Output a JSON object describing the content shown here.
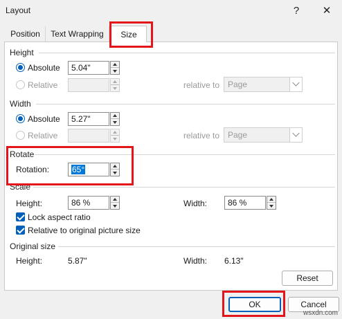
{
  "window": {
    "title": "Layout",
    "help_label": "?",
    "close_label": "✕"
  },
  "tabs": [
    {
      "label": "Position"
    },
    {
      "label": "Text Wrapping"
    },
    {
      "label": "Size"
    }
  ],
  "height": {
    "section": "Height",
    "absolute_label": "Absolute",
    "absolute_value": "5.04\"",
    "relative_label": "Relative",
    "relative_value": "",
    "relative_to_label": "relative to",
    "relative_to_value": "Page"
  },
  "width": {
    "section": "Width",
    "absolute_label": "Absolute",
    "absolute_value": "5.27\"",
    "relative_label": "Relative",
    "relative_value": "",
    "relative_to_label": "relative to",
    "relative_to_value": "Page"
  },
  "rotate": {
    "section": "Rotate",
    "rotation_label": "Rotation:",
    "rotation_value": "65°"
  },
  "scale": {
    "section": "Scale",
    "height_label": "Height:",
    "height_value": "86 %",
    "width_label": "Width:",
    "width_value": "86 %",
    "lock_label": "Lock aspect ratio",
    "relative_label": "Relative to original picture size"
  },
  "original": {
    "section": "Original size",
    "height_label": "Height:",
    "height_value": "5.87\"",
    "width_label": "Width:",
    "width_value": "6.13\""
  },
  "buttons": {
    "reset": "Reset",
    "ok": "OK",
    "cancel": "Cancel"
  },
  "watermark": "wsxdn.com",
  "colors": {
    "accent": "#005fb8",
    "highlight": "#e3151a",
    "selection": "#0078d7"
  }
}
